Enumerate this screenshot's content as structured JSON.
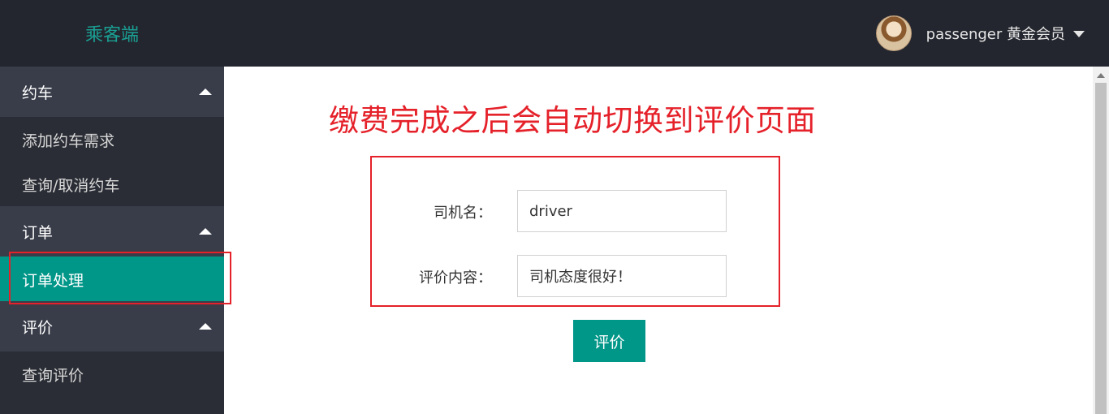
{
  "header": {
    "brand": "乘客端",
    "user_label": "passenger 黄金会员"
  },
  "sidebar": {
    "groups": [
      {
        "label": "约车",
        "items": [
          "添加约车需求",
          "查询/取消约车"
        ]
      },
      {
        "label": "订单",
        "items": [
          "订单处理"
        ]
      },
      {
        "label": "评价",
        "items": [
          "查询评价"
        ]
      }
    ],
    "active_item": "订单处理"
  },
  "main": {
    "annotation": "缴费完成之后会自动切换到评价页面",
    "form": {
      "driver_label": "司机名：",
      "driver_value": "driver",
      "comment_label": "评价内容：",
      "comment_value": "司机态度很好！",
      "submit_label": "评价"
    }
  },
  "colors": {
    "topbar": "#23262e",
    "sidebar": "#2a2d35",
    "group_head": "#393d49",
    "accent": "#009688",
    "brand": "#1aa094",
    "annotation_red": "#e5212a"
  }
}
